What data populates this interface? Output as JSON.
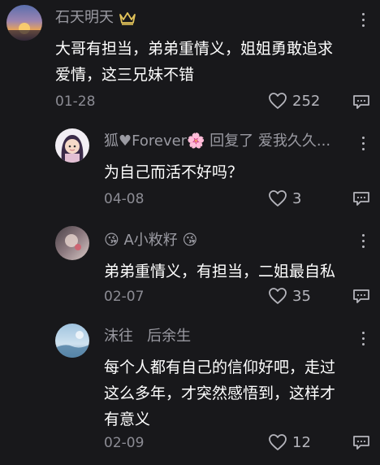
{
  "comments": [
    {
      "name": "石天明天",
      "text_lines": [
        "大哥有担当，弟弟重情义，姐姐勇敢追求",
        "爱情，这三兄妹不错"
      ],
      "date": "01-28",
      "likes": "252"
    },
    {
      "name": "狐♥Forever🌸 回复了 爱我久久...",
      "text_lines": [
        "为自己而活不好吗？"
      ],
      "date": "04-08",
      "likes": "3"
    },
    {
      "name": "😘 A小敉籽 😘",
      "text_lines": [
        "弟弟重情义，有担当，二姐最自私"
      ],
      "date": "02-07",
      "likes": "35"
    },
    {
      "name": "沫往   后余生",
      "text_lines": [
        "每个人都有自己的信仰好吧，走过",
        "这么多年，才突然感悟到，这样才",
        "有意义"
      ],
      "date": "02-09",
      "likes": "12"
    }
  ],
  "icons": {
    "more": "more-vertical-icon",
    "like": "heart-outline-icon",
    "reply": "comment-reply-icon",
    "crown": "crown-badge-icon"
  },
  "colors": {
    "background": "#18181b",
    "name": "#9a9aa2",
    "text": "#ffffff",
    "meta": "#8c8c94"
  }
}
